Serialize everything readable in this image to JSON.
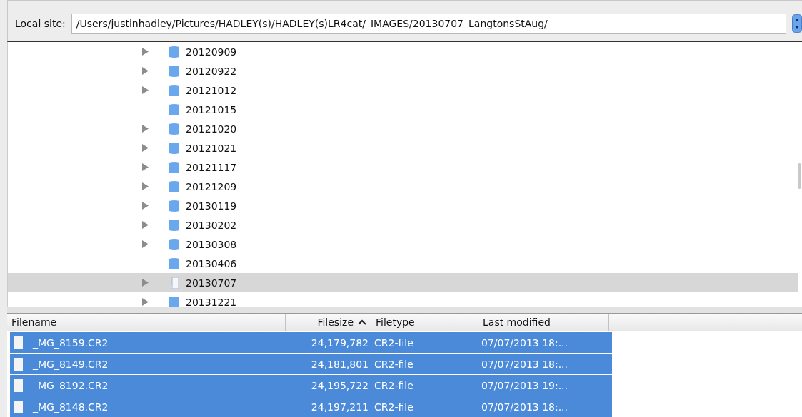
{
  "local_site": {
    "label": "Local site:",
    "path": "/Users/justinhadley/Pictures/HADLEY(s)/HADLEY(s)LR4cat/_IMAGES/20130707_LangtonsStAug/"
  },
  "tree": [
    {
      "name": "20120909",
      "expandable": true,
      "selected": false,
      "kind": "folder"
    },
    {
      "name": "20120922",
      "expandable": true,
      "selected": false,
      "kind": "folder"
    },
    {
      "name": "20121012",
      "expandable": true,
      "selected": false,
      "kind": "folder"
    },
    {
      "name": "20121015",
      "expandable": false,
      "selected": false,
      "kind": "folder"
    },
    {
      "name": "20121020",
      "expandable": true,
      "selected": false,
      "kind": "folder"
    },
    {
      "name": "20121021",
      "expandable": true,
      "selected": false,
      "kind": "folder"
    },
    {
      "name": "20121117",
      "expandable": true,
      "selected": false,
      "kind": "folder"
    },
    {
      "name": "20121209",
      "expandable": true,
      "selected": false,
      "kind": "folder"
    },
    {
      "name": "20130119",
      "expandable": true,
      "selected": false,
      "kind": "folder"
    },
    {
      "name": "20130202",
      "expandable": true,
      "selected": false,
      "kind": "folder"
    },
    {
      "name": "20130308",
      "expandable": true,
      "selected": false,
      "kind": "folder"
    },
    {
      "name": "20130406",
      "expandable": false,
      "selected": false,
      "kind": "folder"
    },
    {
      "name": "20130707",
      "expandable": true,
      "selected": true,
      "kind": "current"
    },
    {
      "name": "20131221",
      "expandable": true,
      "selected": false,
      "kind": "folder"
    }
  ],
  "files": {
    "columns": [
      {
        "label": "Filename",
        "sorted": false
      },
      {
        "label": "Filesize",
        "sorted": true
      },
      {
        "label": "Filetype",
        "sorted": false
      },
      {
        "label": "Last modified",
        "sorted": false
      }
    ],
    "rows": [
      {
        "filename": "_MG_8159.CR2",
        "filesize": "24,179,782",
        "filetype": "CR2-file",
        "modified": "07/07/2013 18:...",
        "selected": true
      },
      {
        "filename": "_MG_8149.CR2",
        "filesize": "24,181,801",
        "filetype": "CR2-file",
        "modified": "07/07/2013 18:...",
        "selected": true
      },
      {
        "filename": "_MG_8192.CR2",
        "filesize": "24,195,722",
        "filetype": "CR2-file",
        "modified": "07/07/2013 19:...",
        "selected": true
      },
      {
        "filename": "_MG_8148.CR2",
        "filesize": "24,197,211",
        "filetype": "CR2-file",
        "modified": "07/07/2013 18:...",
        "selected": true
      }
    ]
  }
}
